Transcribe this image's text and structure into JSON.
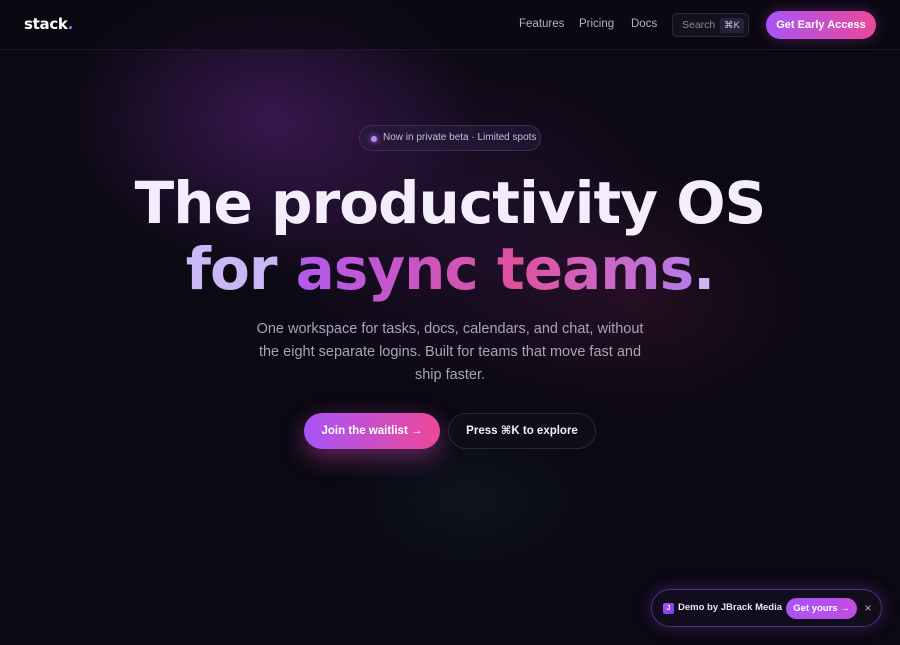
{
  "nav": {
    "logo": "stack",
    "logo_dot": ".",
    "links": [
      "Features",
      "Pricing",
      "Docs"
    ],
    "search": {
      "label": "Search",
      "shortcut": "⌘K"
    },
    "cta": "Get Early Access"
  },
  "hero": {
    "badge": "Now in private beta · Limited spots",
    "headline_line1": "The productivity OS",
    "headline_line2_plain": "for ",
    "headline_line2_highlight": "async teams",
    "headline_line2_end": ".",
    "subtitle": "One workspace for tasks, docs, calendars, and chat, without the eight separate logins. Built for teams that move fast and ship faster.",
    "primary_button": "Join the waitlist →",
    "secondary_button": "Press ⌘K to explore"
  },
  "demo_toast": {
    "icon_letter": "J",
    "text": "Demo by JBrack Media",
    "button": "Get yours →",
    "close": "×"
  },
  "colors": {
    "background": "#0b0912",
    "accent_purple": "#a855f7",
    "accent_pink": "#ec4899",
    "headline": "#f4eefc",
    "subtitle": "#a9a2bd"
  }
}
